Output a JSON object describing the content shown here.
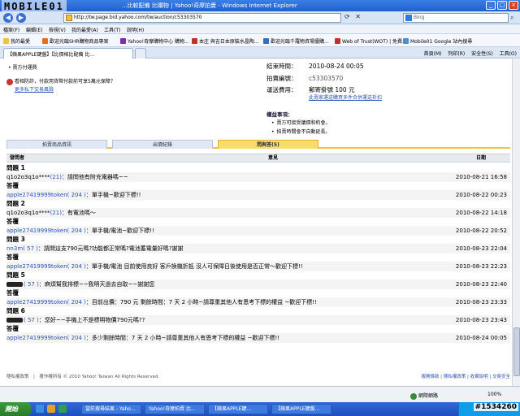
{
  "window": {
    "logo": "MOBILE01",
    "title": "...比較配備 比購物 | Yahoo!奇摩拍賣 - Windows Internet Explorer",
    "address": "http://tw.page.bid.yahoo.com/tw/auction/c53303570",
    "search_placeholder": "Bing"
  },
  "menubar": [
    "檔案(F)",
    "編輯(E)",
    "檢視(V)",
    "我的最愛(A)",
    "工具(T)",
    "說明(H)"
  ],
  "favorites": [
    {
      "label": "我的最愛",
      "color": "#f0c040"
    },
    {
      "label": "歡迎光臨SHR購物商品專案",
      "color": "#e07020"
    },
    {
      "label": "Yahoo!奇摩購物中心 購物...",
      "color": "#7b2db0"
    },
    {
      "label": "本庄 與吉日本原裝水晶陶...",
      "color": "#c03030"
    },
    {
      "label": "歡迎光臨千羅物資場優購...",
      "color": "#3070c0"
    },
    {
      "label": "Web of Trust(WOT) | 免費...",
      "color": "#c03030"
    },
    {
      "label": "Mobile01 Google 站內搜尋",
      "color": "#4a90d0"
    }
  ],
  "tabs": {
    "active": "【蘋果APPLE鍵盤】【比價格比配備 比...",
    "ie_tools": [
      "首頁(M)",
      "列印(R)",
      "安全性(S)",
      "工具(O)"
    ]
  },
  "auction": {
    "bullet_top": "賣方付運費",
    "warning": "看相防詐，付款用貨幣付款前可享5萬元保障？",
    "warning_link": "更多私下交易風險",
    "end_time_label": "結束時間：",
    "end_time": "2010-08-24 00:05",
    "item_id_label": "拍賣編號：",
    "item_id": "c53303570",
    "shipping_label": "運送費用：",
    "shipping": "郵寄掛號 100 元",
    "shipping_link": "此賣家運送購買多件合併運送折扣",
    "notes_title": "權益事項：",
    "notes": [
      "賣方可接受議價和約會。",
      "拍賣時間會不自動延長。"
    ]
  },
  "section_tabs": [
    "拍賣商品資訊",
    "出價紀錄",
    "問與答(5)"
  ],
  "qa_header": {
    "asker": "發問者",
    "question": "意見",
    "date": "日期"
  },
  "qa": [
    {
      "q_label": "問題 1",
      "asker": "q1o2o3q1o****",
      "rating": "(21)",
      "question": "：請問他有附充電器嗎~~",
      "q_time": "2010-08-21 16:58",
      "a_label": "答覆",
      "seller": "apple27419999token",
      "seller_rating": "( 204 )",
      "answer": "：單手機~歡迎下標!!",
      "a_time": "2010-08-22 00:23",
      "masked": false
    },
    {
      "q_label": "問題 2",
      "asker": "q1o2o3q1o****",
      "rating": "(21)",
      "question": "：有電池嗎～",
      "q_time": "2010-08-22 14:18",
      "a_label": "答覆",
      "seller": "apple27419999token",
      "seller_rating": "( 204 )",
      "answer": "：單手機/電池~歡迎下標!!",
      "a_time": "2010-08-22 20:52",
      "masked": false
    },
    {
      "q_label": "問題 3",
      "asker": "nn3m",
      "rating": "( 57 )",
      "question": "：請問這支790元嗎?功能都正常嗎?電池蓄電量好嗎?謝謝",
      "q_time": "2010-08-23 22:04",
      "a_label": "答覆",
      "seller": "apple27419999token",
      "seller_rating": "( 204 )",
      "answer": "：單手機/電池 目前使用良好 客戶換機折抵 沒人可保障日後使用是否正常～歡迎下標!!",
      "a_time": "2010-08-23 22:23",
      "masked": false
    },
    {
      "q_label": "問題 5",
      "asker": "",
      "rating": "( 57 )",
      "question": "：麻煩幫我排標~~我明天過去自取~~謝謝您",
      "q_time": "2010-08-23 22:40",
      "a_label": "答覆",
      "seller": "apple27419999token",
      "seller_rating": "( 204 )",
      "answer": "：目前出價：790 元 剩餘時間：7 天 2 小時~請尊重其他人有恩考下標的權益 ~歡迎下標!!",
      "a_time": "2010-08-23 23:33",
      "masked": true
    },
    {
      "q_label": "問題 6",
      "asker": "",
      "rating": "( 57 )",
      "question": "：您好~~手機上不是標明物價790元嗎??",
      "q_time": "2010-08-23 23:43",
      "a_label": "答覆",
      "seller": "apple27419999token",
      "seller_rating": "( 204 )",
      "answer": "：多少剩餘時間：7 天 2 小時~請尊重其他人有恩考下標的權益 ~歡迎下標!!",
      "a_time": "2010-08-24 00:05",
      "masked": true
    }
  ],
  "footer": {
    "left": "隱私權政策　|　著作權所有 © 2010 Yahoo! Taiwan All Rights Reserved.",
    "right": "服務條款 | 隱私權政策 | 收費說明 | 交易安全"
  },
  "status": {
    "zone": "網際網路",
    "zoom": "100%"
  },
  "taskbar": {
    "start": "開始",
    "tasks": [
      "當前搜尋結果 - Yaho...",
      "Yahoo!奇摩拍賣 比...",
      "【蘋果APPLE鍵...",
      "【蘋果APPLE鍵盤..."
    ],
    "watermark": "#1534260"
  }
}
